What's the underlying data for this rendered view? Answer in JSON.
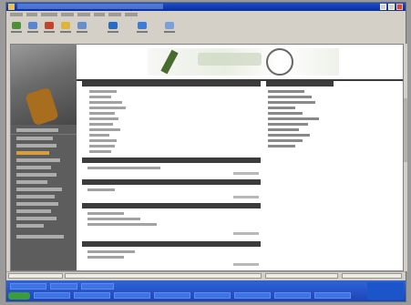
{
  "window": {
    "title": ""
  },
  "menubar": {
    "items": [
      "",
      "",
      "",
      "",
      "",
      "",
      "",
      ""
    ]
  },
  "toolbar": {
    "buttons": [
      {
        "label": "",
        "color": "#4f8f3a"
      },
      {
        "label": "",
        "color": "#5a86cf"
      },
      {
        "label": "",
        "color": "#c2442a"
      },
      {
        "label": "",
        "color": "#e0b33b"
      },
      {
        "label": "",
        "color": "#6a8fc8"
      },
      {
        "label": "",
        "color": "#2a69c4"
      },
      {
        "label": "",
        "color": "#3d7bd6"
      },
      {
        "label": "",
        "color": "#7aa0d6"
      }
    ]
  },
  "banner": {
    "tagline": ""
  },
  "sidebar": {
    "links": [
      "",
      "",
      "",
      "",
      "",
      "",
      "",
      "",
      "",
      "",
      "",
      "",
      "",
      "",
      ""
    ]
  },
  "main": {
    "sections": [
      {
        "heading": "",
        "more": ""
      },
      {
        "heading": "",
        "more": ""
      },
      {
        "heading": "",
        "more": ""
      },
      {
        "heading": "",
        "more": ""
      }
    ]
  },
  "right_col": {
    "heading": "",
    "links": [
      "",
      "",
      "",
      "",
      "",
      "",
      "",
      "",
      "",
      "",
      ""
    ]
  },
  "statusbar": {
    "fields": [
      "",
      "",
      "",
      ""
    ]
  },
  "taskbar": {
    "start": "",
    "apps": [
      "",
      "",
      "",
      "",
      "",
      "",
      "",
      ""
    ]
  },
  "colors": {
    "accent": "#1a4fd0",
    "sidebar_bg": "#5d5d5d",
    "section_bar": "#3c3c3c",
    "taskbar": "#2f63d9"
  }
}
